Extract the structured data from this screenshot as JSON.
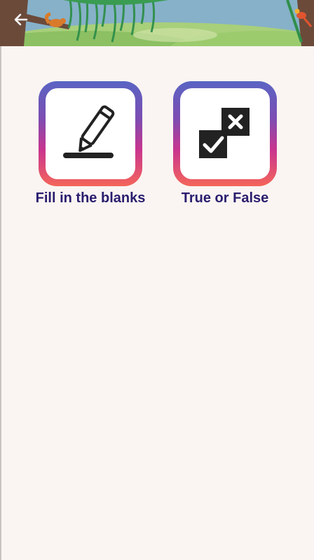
{
  "header": {
    "back_icon": "arrow-left-icon",
    "colors": {
      "sky": "#6f9bbf",
      "grass": "#7bb35d",
      "leaves": "#2f8f4a",
      "trunk": "#6b4a3a"
    }
  },
  "options": [
    {
      "label": "Fill in the blanks",
      "icon": "pencil-underline-icon"
    },
    {
      "label": "True or False",
      "icon": "check-cross-icon"
    }
  ],
  "colors": {
    "background": "#faf5f2",
    "label_text": "#2a1d6e",
    "tile_gradient": [
      "#5a64c3",
      "#7b4db3",
      "#c8358f",
      "#f4655a"
    ],
    "icon": "#222222"
  }
}
